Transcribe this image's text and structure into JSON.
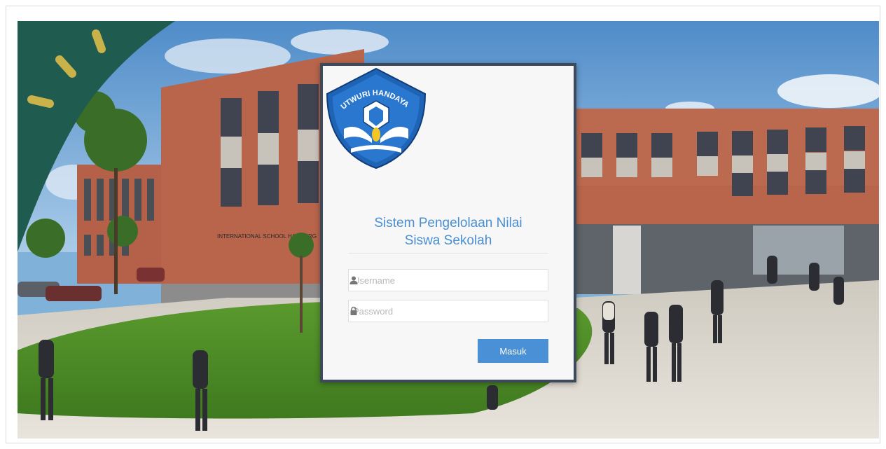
{
  "login": {
    "title_line1": "Sistem Pengelolaan Nilai",
    "title_line2": "Siswa Sekolah",
    "username_placeholder": "Username",
    "password_placeholder": "Password",
    "submit_label": "Masuk",
    "logo_text": "TUTWURI HANDAYANI"
  },
  "background": {
    "sign_text": "INTERNATIONAL SCHOOL HAMBURG"
  },
  "colors": {
    "accent": "#4a90d6",
    "card_border": "#3d4a5c",
    "decor_green": "#1f5c4f",
    "decor_yellow": "#c9b24a"
  },
  "icons": [
    "user-icon",
    "lock-icon"
  ]
}
